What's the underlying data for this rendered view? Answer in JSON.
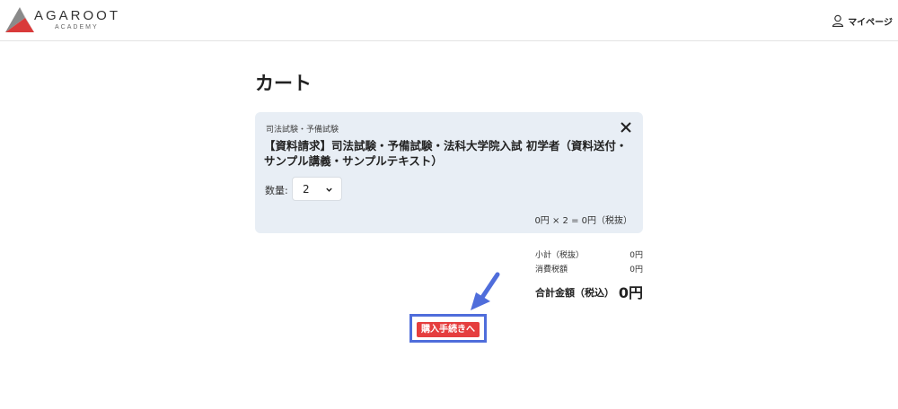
{
  "header": {
    "logo_main": "AGAROOT",
    "logo_sub": "ACADEMY",
    "mypage_label": "マイページ"
  },
  "page_title": "カート",
  "cart_item": {
    "category": "司法試験・予備試験",
    "product_name": "【資料請求】司法試験・予備試験・法科大学院入試 初学者（資料送付・サンプル講義・サンプルテキスト）",
    "quantity_label": "数量:",
    "quantity_value": "2",
    "price_line": "0円 × 2 = 0円（税抜）"
  },
  "totals": {
    "subtotal_label": "小計（税抜）",
    "subtotal_value": "0円",
    "tax_label": "消費税額",
    "tax_value": "0円",
    "total_label": "合計金額（税込）",
    "total_value": "0円"
  },
  "checkout": {
    "button_label": "購入手続きへ"
  },
  "icons": {
    "mypage": "user-icon",
    "close": "close-icon",
    "chevron": "chevron-down-icon",
    "annotation": "arrow-annotation"
  },
  "colors": {
    "card_bg": "#e8eef5",
    "checkout_bg": "#e53e3e",
    "highlight": "#4f6ddb"
  }
}
